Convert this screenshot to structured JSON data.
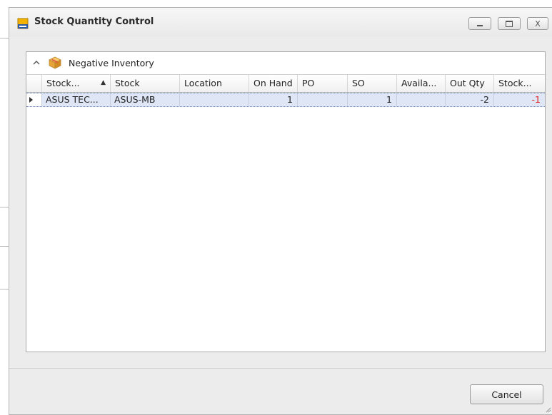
{
  "window": {
    "title": "Stock Quantity Control",
    "controls": {
      "minimize_icon": "minimize-icon",
      "maximize_icon": "maximize-icon",
      "close_glyph": "X"
    }
  },
  "group": {
    "title": "Negative Inventory",
    "collapse_glyph": "^",
    "icon": "box-icon"
  },
  "grid": {
    "columns": [
      "Stock...",
      "Stock",
      "Location",
      "On Hand",
      "PO",
      "SO",
      "Availa...",
      "Out Qty",
      "Stock..."
    ],
    "sort_glyph": "▲",
    "rows": [
      {
        "stock_code": "ASUS TEC...",
        "stock": "ASUS-MB",
        "location": "",
        "on_hand": "1",
        "po": "",
        "so": "1",
        "available": "",
        "out_qty": "-2",
        "stock_balance": "-1"
      }
    ]
  },
  "footer": {
    "cancel_label": "Cancel"
  },
  "colors": {
    "negative": "#e02020",
    "selected_row": "#dfe6f6"
  }
}
